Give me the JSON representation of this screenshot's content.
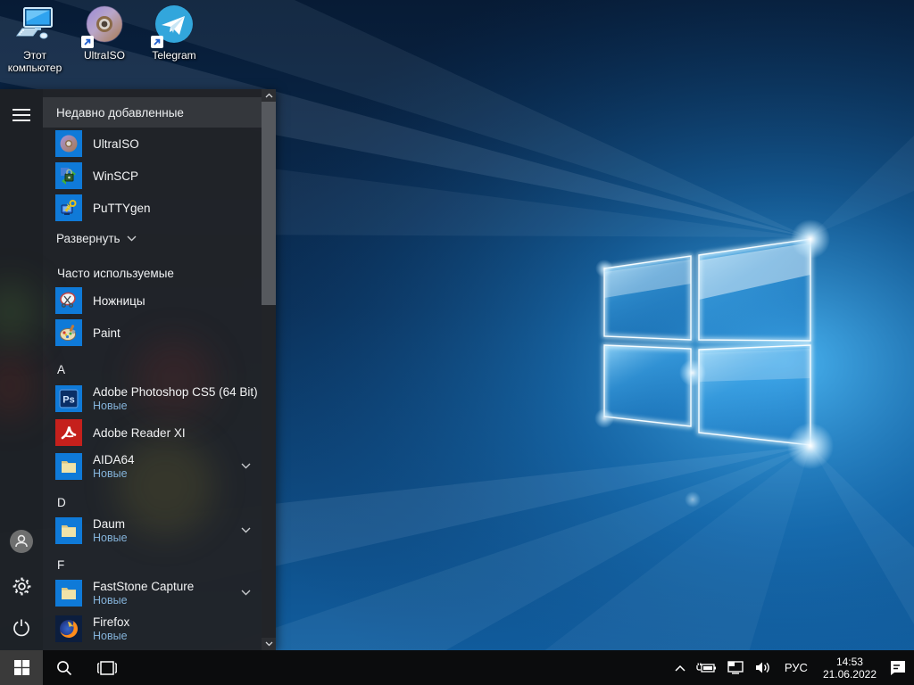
{
  "desktop": {
    "icons": [
      {
        "label": "Этот компьютер",
        "icon": "this-pc-icon",
        "shortcut": false
      },
      {
        "label": "UltraISO",
        "icon": "ultraiso-icon",
        "shortcut": true
      },
      {
        "label": "Telegram",
        "icon": "telegram-icon",
        "shortcut": true
      }
    ]
  },
  "start_menu": {
    "recent_header": "Недавно добавленные",
    "recent": [
      {
        "name": "UltraISO",
        "icon": "ultraiso-icon"
      },
      {
        "name": "WinSCP",
        "icon": "winscp-icon"
      },
      {
        "name": "PuTTYgen",
        "icon": "puttygen-icon"
      }
    ],
    "expand_label": "Развернуть",
    "frequent_header": "Часто используемые",
    "frequent": [
      {
        "name": "Ножницы",
        "icon": "snipping-tool-icon"
      },
      {
        "name": "Paint",
        "icon": "paint-icon"
      }
    ],
    "sections": [
      {
        "letter": "A",
        "apps": [
          {
            "name": "Adobe Photoshop CS5 (64 Bit)",
            "badge": "Новые",
            "icon": "photoshop-icon"
          },
          {
            "name": "Adobe Reader XI",
            "icon": "adobe-reader-icon"
          },
          {
            "name": "AIDA64",
            "badge": "Новые",
            "icon": "folder-icon",
            "expandable": true
          }
        ]
      },
      {
        "letter": "D",
        "apps": [
          {
            "name": "Daum",
            "badge": "Новые",
            "icon": "folder-icon",
            "expandable": true
          }
        ]
      },
      {
        "letter": "F",
        "apps": [
          {
            "name": "FastStone Capture",
            "badge": "Новые",
            "icon": "folder-icon",
            "expandable": true
          },
          {
            "name": "Firefox",
            "badge": "Новые",
            "icon": "firefox-icon"
          }
        ]
      }
    ],
    "sidebar_icons": [
      "hamburger-icon",
      "user-icon",
      "settings-gear-icon",
      "power-icon"
    ],
    "ps_tile_label": "Ps"
  },
  "taskbar": {
    "start_icon": "windows-logo-icon",
    "search_icon": "search-icon",
    "task_view_icon": "task-view-icon",
    "tray_icons": [
      "chevron-up-icon",
      "battery-plugged-icon",
      "network-ethernet-icon",
      "volume-icon",
      "action-center-icon"
    ],
    "language": "РУС",
    "time": "14:53",
    "date": "21.06.2022"
  },
  "colors": {
    "tile_blue": "#0f7ad8",
    "badge_text": "#84b3da",
    "menu_bg": "#212327",
    "taskbar_bg": "#0b0c0d",
    "start_button_active": "#3a3a3a",
    "wallpaper_accent": "#2196e8"
  }
}
